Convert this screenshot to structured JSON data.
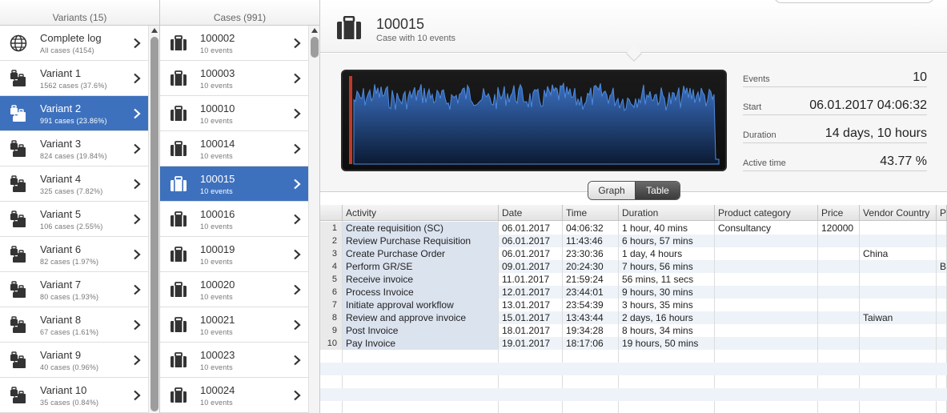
{
  "variants": {
    "header": "Variants (15)",
    "items": [
      {
        "title": "Complete log",
        "sub": "All cases (4154)",
        "icon": "globe-icon",
        "selected": false
      },
      {
        "title": "Variant 1",
        "sub": "1562 cases (37.6%)",
        "icon": "variant-stack-icon",
        "selected": false
      },
      {
        "title": "Variant 2",
        "sub": "991 cases (23.86%)",
        "icon": "variant-stack-icon",
        "selected": true
      },
      {
        "title": "Variant 3",
        "sub": "824 cases (19.84%)",
        "icon": "variant-stack-icon",
        "selected": false
      },
      {
        "title": "Variant 4",
        "sub": "325 cases (7.82%)",
        "icon": "variant-stack-icon",
        "selected": false
      },
      {
        "title": "Variant 5",
        "sub": "106 cases (2.55%)",
        "icon": "variant-stack-icon",
        "selected": false
      },
      {
        "title": "Variant 6",
        "sub": "82 cases (1.97%)",
        "icon": "variant-stack-icon",
        "selected": false
      },
      {
        "title": "Variant 7",
        "sub": "80 cases (1.93%)",
        "icon": "variant-stack-icon",
        "selected": false
      },
      {
        "title": "Variant 8",
        "sub": "67 cases (1.61%)",
        "icon": "variant-stack-icon",
        "selected": false
      },
      {
        "title": "Variant 9",
        "sub": "40 cases (0.96%)",
        "icon": "variant-stack-icon",
        "selected": false
      },
      {
        "title": "Variant 10",
        "sub": "35 cases (0.84%)",
        "icon": "variant-stack-icon",
        "selected": false
      }
    ]
  },
  "cases": {
    "header": "Cases (991)",
    "items": [
      {
        "title": "100002",
        "sub": "10 events",
        "selected": false
      },
      {
        "title": "100003",
        "sub": "10 events",
        "selected": false
      },
      {
        "title": "100010",
        "sub": "10 events",
        "selected": false
      },
      {
        "title": "100014",
        "sub": "10 events",
        "selected": false
      },
      {
        "title": "100015",
        "sub": "10 events",
        "selected": true
      },
      {
        "title": "100016",
        "sub": "10 events",
        "selected": false
      },
      {
        "title": "100019",
        "sub": "10 events",
        "selected": false
      },
      {
        "title": "100020",
        "sub": "10 events",
        "selected": false
      },
      {
        "title": "100021",
        "sub": "10 events",
        "selected": false
      },
      {
        "title": "100023",
        "sub": "10 events",
        "selected": false
      },
      {
        "title": "100024",
        "sub": "10 events",
        "selected": false
      }
    ]
  },
  "detail": {
    "case_id": "100015",
    "case_desc": "Case with 10 events",
    "stats": [
      {
        "label": "Events",
        "value": "10"
      },
      {
        "label": "Start",
        "value": "06.01.2017 04:06:32"
      },
      {
        "label": "Duration",
        "value": "14 days, 10 hours"
      },
      {
        "label": "Active time",
        "value": "43.77 %"
      }
    ],
    "view_toggle": {
      "graph": "Graph",
      "table": "Table",
      "active": "table"
    }
  },
  "table": {
    "columns": [
      "Activity",
      "Date",
      "Time",
      "Duration",
      "Product category",
      "Price",
      "Vendor Country",
      "P"
    ],
    "rows": [
      {
        "n": "1",
        "activity": "Create requisition (SC)",
        "date": "06.01.2017",
        "time": "04:06:32",
        "duration": "1 hour, 40 mins",
        "category": "Consultancy",
        "price": "120000",
        "country": "",
        "p": ""
      },
      {
        "n": "2",
        "activity": "Review Purchase Requisition",
        "date": "06.01.2017",
        "time": "11:43:46",
        "duration": "6 hours, 57 mins",
        "category": "",
        "price": "",
        "country": "",
        "p": ""
      },
      {
        "n": "3",
        "activity": "Create Purchase Order",
        "date": "06.01.2017",
        "time": "23:30:36",
        "duration": "1 day, 4 hours",
        "category": "",
        "price": "",
        "country": "China",
        "p": ""
      },
      {
        "n": "4",
        "activity": "Perform GR/SE",
        "date": "09.01.2017",
        "time": "20:24:30",
        "duration": "7 hours, 56 mins",
        "category": "",
        "price": "",
        "country": "",
        "p": "B"
      },
      {
        "n": "5",
        "activity": "Receive invoice",
        "date": "11.01.2017",
        "time": "21:59:24",
        "duration": "56 mins, 11 secs",
        "category": "",
        "price": "",
        "country": "",
        "p": ""
      },
      {
        "n": "6",
        "activity": "Process Invoice",
        "date": "12.01.2017",
        "time": "23:44:01",
        "duration": "9 hours, 30 mins",
        "category": "",
        "price": "",
        "country": "",
        "p": ""
      },
      {
        "n": "7",
        "activity": "Initiate approval workflow",
        "date": "13.01.2017",
        "time": "23:54:39",
        "duration": "3 hours, 35 mins",
        "category": "",
        "price": "",
        "country": "",
        "p": ""
      },
      {
        "n": "8",
        "activity": "Review and approve invoice",
        "date": "15.01.2017",
        "time": "13:43:44",
        "duration": "2 days, 16 hours",
        "category": "",
        "price": "",
        "country": "Taiwan",
        "p": ""
      },
      {
        "n": "9",
        "activity": "Post Invoice",
        "date": "18.01.2017",
        "time": "19:34:28",
        "duration": "8 hours, 34 mins",
        "category": "",
        "price": "",
        "country": "",
        "p": ""
      },
      {
        "n": "10",
        "activity": "Pay Invoice",
        "date": "19.01.2017",
        "time": "18:17:06",
        "duration": "19 hours, 50 mins",
        "category": "",
        "price": "",
        "country": "",
        "p": ""
      }
    ]
  },
  "colors": {
    "accent": "#3e71bd",
    "graph_line": "#3f7fd6",
    "graph_marker": "#c0392b"
  }
}
